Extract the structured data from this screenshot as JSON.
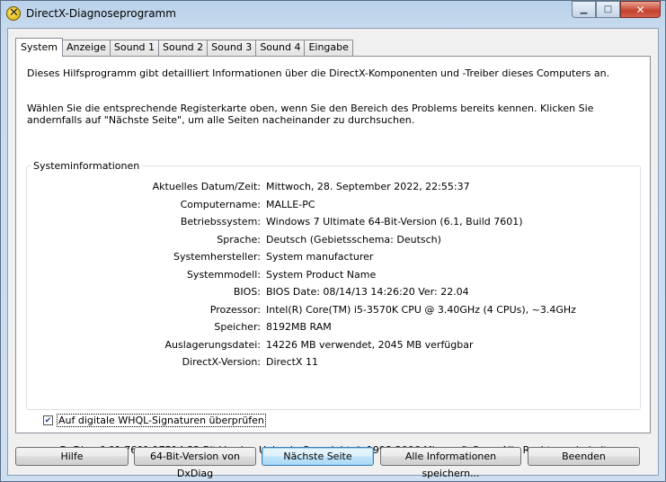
{
  "window": {
    "title": "DirectX-Diagnoseprogramm"
  },
  "tabs": [
    "System",
    "Anzeige",
    "Sound 1",
    "Sound 2",
    "Sound 3",
    "Sound 4",
    "Eingabe"
  ],
  "intro": {
    "line1": "Dieses Hilfsprogramm gibt detailliert Informationen über die DirectX-Komponenten und -Treiber dieses Computers an.",
    "line2": "Wählen Sie die entsprechende Registerkarte oben, wenn Sie den Bereich des Problems bereits kennen. Klicken Sie andernfalls auf \"Nächste Seite\", um alle Seiten nacheinander zu durchsuchen."
  },
  "sysinfo": {
    "group_label": "Systeminformationen",
    "rows": [
      {
        "label": "Aktuelles Datum/Zeit:",
        "value": "Mittwoch, 28. September 2022, 22:55:37"
      },
      {
        "label": "Computername:",
        "value": "MALLE-PC"
      },
      {
        "label": "Betriebssystem:",
        "value": "Windows 7 Ultimate 64-Bit-Version (6.1, Build 7601)"
      },
      {
        "label": "Sprache:",
        "value": "Deutsch (Gebietsschema: Deutsch)"
      },
      {
        "label": "Systemhersteller:",
        "value": "System manufacturer"
      },
      {
        "label": "Systemmodell:",
        "value": "System Product Name"
      },
      {
        "label": "BIOS:",
        "value": "BIOS Date: 08/14/13 14:26:20 Ver: 22.04"
      },
      {
        "label": "Prozessor:",
        "value": "Intel(R) Core(TM) i5-3570K CPU @ 3.40GHz (4 CPUs), ~3.4GHz"
      },
      {
        "label": "Speicher:",
        "value": "8192MB RAM"
      },
      {
        "label": "Auslagerungsdatei:",
        "value": "14226 MB verwendet, 2045 MB verfügbar"
      },
      {
        "label": "DirectX-Version:",
        "value": "DirectX 11"
      }
    ]
  },
  "whql_checkbox": {
    "label": "Auf digitale WHQL-Signaturen überprüfen",
    "checked": true
  },
  "footer": "DxDiag 6.01.7601.17514 32-Bit-Version Unicode Copyright © 1998-2006 Microsoft Corp. Alle Rechte vorbehalten.",
  "buttons": {
    "help": "Hilfe",
    "x64": "64-Bit-Version von DxDiag",
    "next": "Nächste Seite",
    "save": "Alle Informationen speichern...",
    "exit": "Beenden"
  },
  "icons": {
    "app": "directx-icon",
    "minimize": "minimize-icon",
    "maximize": "maximize-icon",
    "close": "close-icon"
  }
}
